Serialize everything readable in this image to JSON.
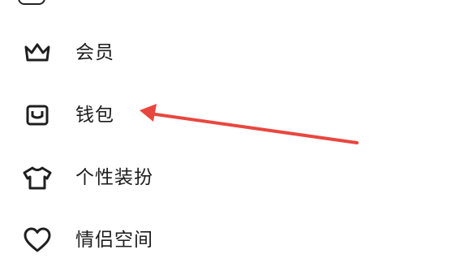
{
  "menu": {
    "items": [
      {
        "label": "会员",
        "icon": "crown-icon"
      },
      {
        "label": "钱包",
        "icon": "wallet-icon"
      },
      {
        "label": "个性装扮",
        "icon": "tshirt-icon"
      },
      {
        "label": "情侣空间",
        "icon": "heart-icon"
      }
    ]
  },
  "annotation": {
    "arrow_color": "#e8473f",
    "points_to": "钱包"
  }
}
